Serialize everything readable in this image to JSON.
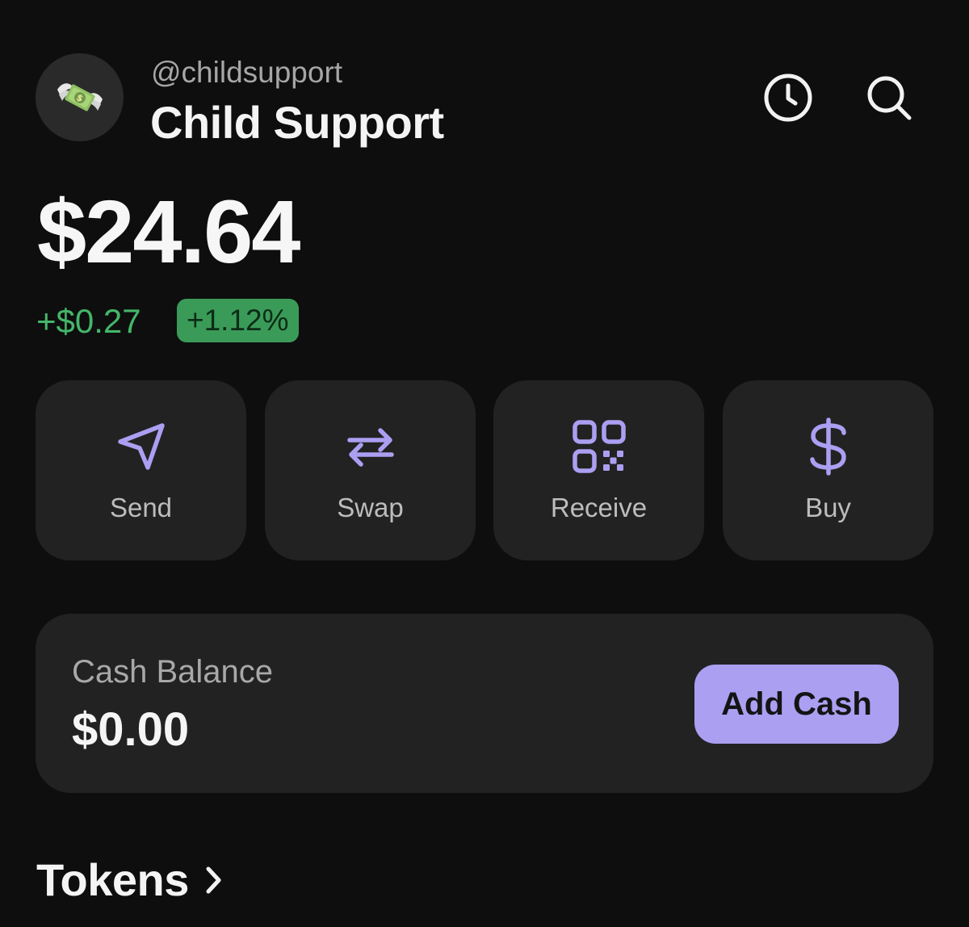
{
  "account": {
    "handle": "@childsupport",
    "name": "Child Support",
    "avatar_icon": "money-with-wings-icon"
  },
  "header_actions": {
    "history_icon": "clock-icon",
    "search_icon": "search-icon"
  },
  "portfolio": {
    "balance": "$24.64",
    "change_amount": "+$0.27",
    "change_percent": "+1.12%"
  },
  "actions": [
    {
      "label": "Send",
      "icon": "send-icon"
    },
    {
      "label": "Swap",
      "icon": "swap-arrows-icon"
    },
    {
      "label": "Receive",
      "icon": "qr-code-icon"
    },
    {
      "label": "Buy",
      "icon": "dollar-icon"
    }
  ],
  "cash": {
    "label": "Cash Balance",
    "value": "$0.00",
    "button_label": "Add Cash"
  },
  "tokens": {
    "title": "Tokens",
    "chevron_icon": "chevron-right-icon"
  },
  "colors": {
    "background": "#0e0e0e",
    "card": "#222222",
    "accent": "#ab9ff2",
    "positive": "#44b66a"
  }
}
